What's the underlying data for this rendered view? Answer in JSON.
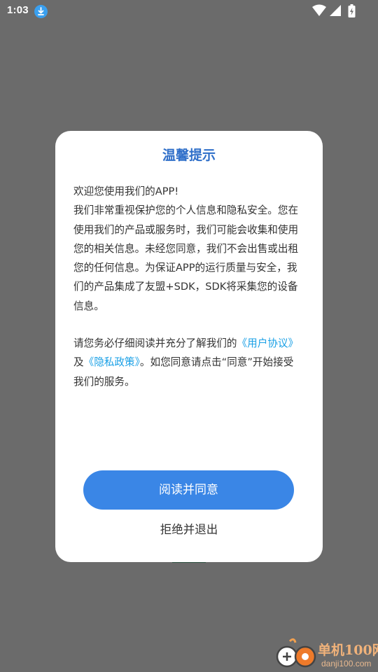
{
  "status_bar": {
    "time": "1:03",
    "icons": [
      "download-icon",
      "wifi-icon",
      "signal-icon",
      "battery-charging-icon"
    ]
  },
  "dialog": {
    "title": "温馨提示",
    "body": {
      "line1": "欢迎您使用我们的APP!",
      "paragraph1": "我们非常重视保护您的个人信息和隐私安全。您在使用我们的产品或服务时，我们可能会收集和使用您的相关信息。未经您同意，我们不会出售或出租您的任何信息。为保证APP的运行质量与安全，我们的产品集成了友盟+SDK，SDK将采集您的设备信息。",
      "paragraph2_prefix": "请您务必仔细阅读并充分了解我们的",
      "user_agreement_link": "《用户协议》",
      "and": "及",
      "privacy_policy_link": "《隐私政策》",
      "paragraph2_suffix": "。如您同意请点击“同意”开始接受我们的服务。"
    },
    "agree_label": "阅读并同意",
    "reject_label": "拒绝并退出"
  },
  "watermark": {
    "name": "单机100网",
    "url": "danji100.com"
  },
  "colors": {
    "scrim": "#6b6b6b",
    "title": "#2f6fc9",
    "link": "#1aa0e6",
    "button": "#3a86e6"
  }
}
